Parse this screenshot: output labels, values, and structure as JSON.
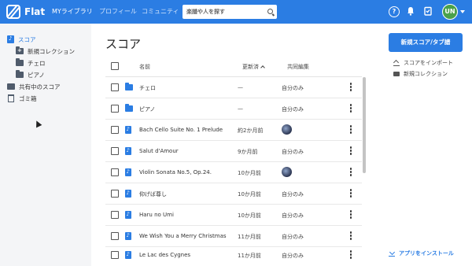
{
  "app": {
    "logo_text": "Flat",
    "brand_color": "#2b7de3"
  },
  "topnav": {
    "items": [
      "MYライブラリ",
      "プロフィール",
      "コミュニティ"
    ],
    "search_placeholder": "楽譜や人を探す",
    "avatar_initials": "UN",
    "icons": [
      "help-icon",
      "bell-icon",
      "tasks-icon"
    ]
  },
  "sidebar": {
    "scores_label": "スコア",
    "new_collection_label": "新規コレクション",
    "folders": [
      "チェロ",
      "ピアノ"
    ],
    "shared_label": "共有中のスコア",
    "trash_label": "ゴミ箱"
  },
  "main": {
    "title": "スコア",
    "columns": {
      "name": "名前",
      "updated": "更新済",
      "shared": "共同編集"
    },
    "rows": [
      {
        "type": "folder",
        "name": "チェロ",
        "updated": "—",
        "shared": "自分のみ"
      },
      {
        "type": "folder",
        "name": "ピアノ",
        "updated": "—",
        "shared": "自分のみ"
      },
      {
        "type": "score",
        "name": "Bach Cello Suite No. 1 Prelude",
        "updated": "約2か月前",
        "shared": "avatar"
      },
      {
        "type": "score",
        "name": "Salut d'Amour",
        "updated": "9か月前",
        "shared": "自分のみ"
      },
      {
        "type": "score",
        "name": "Violin Sonata No.5, Op.24.",
        "updated": "10か月前",
        "shared": "avatar"
      },
      {
        "type": "score",
        "name": "仰げば尊し",
        "updated": "10か月前",
        "shared": "自分のみ"
      },
      {
        "type": "score",
        "name": "Haru no Umi",
        "updated": "10か月前",
        "shared": "自分のみ"
      },
      {
        "type": "score",
        "name": "We Wish You a Merry Christmas",
        "updated": "11か月前",
        "shared": "自分のみ"
      },
      {
        "type": "score",
        "name": "Le Lac des Cygnes",
        "updated": "11か月前",
        "shared": "自分のみ"
      }
    ]
  },
  "right_panel": {
    "new_button_label": "新規スコア/タブ譜",
    "import_label": "スコアをインポート",
    "new_collection_label": "新規コレクション",
    "install_label": "アプリをインストール"
  }
}
